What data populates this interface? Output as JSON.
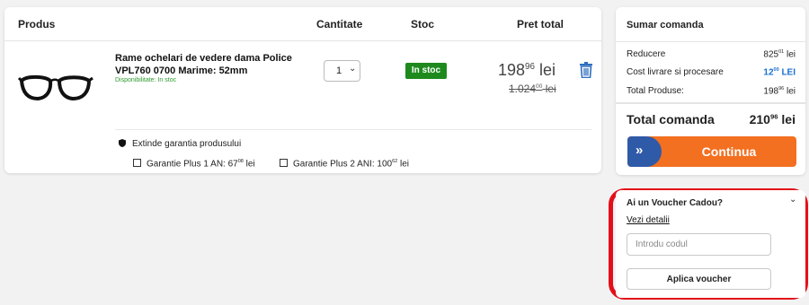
{
  "cart": {
    "headers": {
      "product": "Produs",
      "quantity": "Cantitate",
      "stock": "Stoc",
      "total_price": "Pret total"
    },
    "item": {
      "name": "Rame ochelari de vedere dama Police VPL760 0700 Marime: 52mm",
      "availability": "Disponibilitate: In stoc",
      "quantity": "1",
      "stock_badge": "In stoc",
      "price_int": "198",
      "price_dec": "96",
      "price_currency": "lei",
      "old_price_int": "1.024",
      "old_price_dec": "00",
      "old_price_currency": "lei",
      "delete_icon": "trash-icon",
      "image_icon": "glasses-icon"
    },
    "warranty": {
      "title": "Extinde garantia produsului",
      "icon": "shield-icon",
      "options": [
        {
          "label": "Garantie Plus 1 AN:",
          "price_int": "67",
          "price_dec": "08",
          "currency": "lei"
        },
        {
          "label": "Garantie Plus 2 ANI:",
          "price_int": "100",
          "price_dec": "62",
          "currency": "lei"
        }
      ]
    }
  },
  "summary": {
    "title": "Sumar comanda",
    "rows": [
      {
        "label": "Reducere",
        "val_int": "825",
        "val_dec": "01",
        "currency": "lei"
      },
      {
        "label": "Cost livrare si procesare",
        "val_int": "12",
        "val_dec": "00",
        "currency": "LEI"
      },
      {
        "label": "Total Produse:",
        "val_int": "198",
        "val_dec": "96",
        "currency": "lei"
      }
    ],
    "total_label": "Total comanda",
    "total_int": "210",
    "total_dec": "96",
    "total_currency": "lei",
    "cta_label": "Continua",
    "cta_icon": "double-chevron-right-icon"
  },
  "voucher": {
    "title": "Ai un Voucher Cadou?",
    "details_link": "Vezi detalii",
    "input_placeholder": "Introdu codul",
    "apply_label": "Aplica voucher",
    "chevron_icon": "chevron-down-icon"
  },
  "colors": {
    "accent_orange": "#f37021",
    "accent_blue": "#2f5aa8",
    "stock_green": "#1e8a1e",
    "highlight_red": "#e3101a",
    "link_blue": "#1a6fd0"
  }
}
